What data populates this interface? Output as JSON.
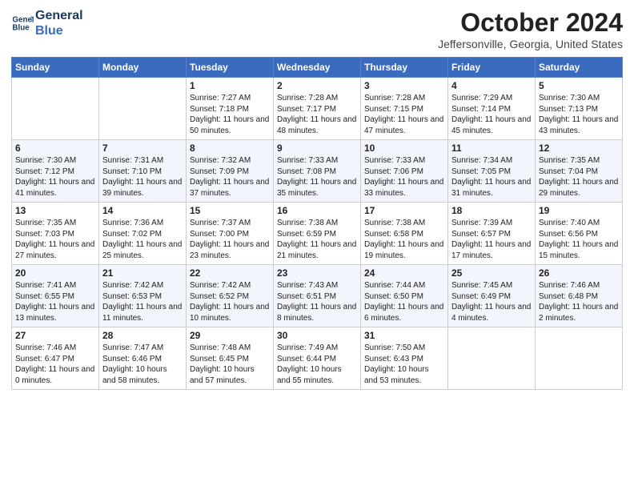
{
  "header": {
    "logo_line1": "General",
    "logo_line2": "Blue",
    "month_title": "October 2024",
    "location": "Jeffersonville, Georgia, United States"
  },
  "days_of_week": [
    "Sunday",
    "Monday",
    "Tuesday",
    "Wednesday",
    "Thursday",
    "Friday",
    "Saturday"
  ],
  "weeks": [
    [
      {
        "day": "",
        "sunrise": "",
        "sunset": "",
        "daylight": ""
      },
      {
        "day": "",
        "sunrise": "",
        "sunset": "",
        "daylight": ""
      },
      {
        "day": "1",
        "sunrise": "Sunrise: 7:27 AM",
        "sunset": "Sunset: 7:18 PM",
        "daylight": "Daylight: 11 hours and 50 minutes."
      },
      {
        "day": "2",
        "sunrise": "Sunrise: 7:28 AM",
        "sunset": "Sunset: 7:17 PM",
        "daylight": "Daylight: 11 hours and 48 minutes."
      },
      {
        "day": "3",
        "sunrise": "Sunrise: 7:28 AM",
        "sunset": "Sunset: 7:15 PM",
        "daylight": "Daylight: 11 hours and 47 minutes."
      },
      {
        "day": "4",
        "sunrise": "Sunrise: 7:29 AM",
        "sunset": "Sunset: 7:14 PM",
        "daylight": "Daylight: 11 hours and 45 minutes."
      },
      {
        "day": "5",
        "sunrise": "Sunrise: 7:30 AM",
        "sunset": "Sunset: 7:13 PM",
        "daylight": "Daylight: 11 hours and 43 minutes."
      }
    ],
    [
      {
        "day": "6",
        "sunrise": "Sunrise: 7:30 AM",
        "sunset": "Sunset: 7:12 PM",
        "daylight": "Daylight: 11 hours and 41 minutes."
      },
      {
        "day": "7",
        "sunrise": "Sunrise: 7:31 AM",
        "sunset": "Sunset: 7:10 PM",
        "daylight": "Daylight: 11 hours and 39 minutes."
      },
      {
        "day": "8",
        "sunrise": "Sunrise: 7:32 AM",
        "sunset": "Sunset: 7:09 PM",
        "daylight": "Daylight: 11 hours and 37 minutes."
      },
      {
        "day": "9",
        "sunrise": "Sunrise: 7:33 AM",
        "sunset": "Sunset: 7:08 PM",
        "daylight": "Daylight: 11 hours and 35 minutes."
      },
      {
        "day": "10",
        "sunrise": "Sunrise: 7:33 AM",
        "sunset": "Sunset: 7:06 PM",
        "daylight": "Daylight: 11 hours and 33 minutes."
      },
      {
        "day": "11",
        "sunrise": "Sunrise: 7:34 AM",
        "sunset": "Sunset: 7:05 PM",
        "daylight": "Daylight: 11 hours and 31 minutes."
      },
      {
        "day": "12",
        "sunrise": "Sunrise: 7:35 AM",
        "sunset": "Sunset: 7:04 PM",
        "daylight": "Daylight: 11 hours and 29 minutes."
      }
    ],
    [
      {
        "day": "13",
        "sunrise": "Sunrise: 7:35 AM",
        "sunset": "Sunset: 7:03 PM",
        "daylight": "Daylight: 11 hours and 27 minutes."
      },
      {
        "day": "14",
        "sunrise": "Sunrise: 7:36 AM",
        "sunset": "Sunset: 7:02 PM",
        "daylight": "Daylight: 11 hours and 25 minutes."
      },
      {
        "day": "15",
        "sunrise": "Sunrise: 7:37 AM",
        "sunset": "Sunset: 7:00 PM",
        "daylight": "Daylight: 11 hours and 23 minutes."
      },
      {
        "day": "16",
        "sunrise": "Sunrise: 7:38 AM",
        "sunset": "Sunset: 6:59 PM",
        "daylight": "Daylight: 11 hours and 21 minutes."
      },
      {
        "day": "17",
        "sunrise": "Sunrise: 7:38 AM",
        "sunset": "Sunset: 6:58 PM",
        "daylight": "Daylight: 11 hours and 19 minutes."
      },
      {
        "day": "18",
        "sunrise": "Sunrise: 7:39 AM",
        "sunset": "Sunset: 6:57 PM",
        "daylight": "Daylight: 11 hours and 17 minutes."
      },
      {
        "day": "19",
        "sunrise": "Sunrise: 7:40 AM",
        "sunset": "Sunset: 6:56 PM",
        "daylight": "Daylight: 11 hours and 15 minutes."
      }
    ],
    [
      {
        "day": "20",
        "sunrise": "Sunrise: 7:41 AM",
        "sunset": "Sunset: 6:55 PM",
        "daylight": "Daylight: 11 hours and 13 minutes."
      },
      {
        "day": "21",
        "sunrise": "Sunrise: 7:42 AM",
        "sunset": "Sunset: 6:53 PM",
        "daylight": "Daylight: 11 hours and 11 minutes."
      },
      {
        "day": "22",
        "sunrise": "Sunrise: 7:42 AM",
        "sunset": "Sunset: 6:52 PM",
        "daylight": "Daylight: 11 hours and 10 minutes."
      },
      {
        "day": "23",
        "sunrise": "Sunrise: 7:43 AM",
        "sunset": "Sunset: 6:51 PM",
        "daylight": "Daylight: 11 hours and 8 minutes."
      },
      {
        "day": "24",
        "sunrise": "Sunrise: 7:44 AM",
        "sunset": "Sunset: 6:50 PM",
        "daylight": "Daylight: 11 hours and 6 minutes."
      },
      {
        "day": "25",
        "sunrise": "Sunrise: 7:45 AM",
        "sunset": "Sunset: 6:49 PM",
        "daylight": "Daylight: 11 hours and 4 minutes."
      },
      {
        "day": "26",
        "sunrise": "Sunrise: 7:46 AM",
        "sunset": "Sunset: 6:48 PM",
        "daylight": "Daylight: 11 hours and 2 minutes."
      }
    ],
    [
      {
        "day": "27",
        "sunrise": "Sunrise: 7:46 AM",
        "sunset": "Sunset: 6:47 PM",
        "daylight": "Daylight: 11 hours and 0 minutes."
      },
      {
        "day": "28",
        "sunrise": "Sunrise: 7:47 AM",
        "sunset": "Sunset: 6:46 PM",
        "daylight": "Daylight: 10 hours and 58 minutes."
      },
      {
        "day": "29",
        "sunrise": "Sunrise: 7:48 AM",
        "sunset": "Sunset: 6:45 PM",
        "daylight": "Daylight: 10 hours and 57 minutes."
      },
      {
        "day": "30",
        "sunrise": "Sunrise: 7:49 AM",
        "sunset": "Sunset: 6:44 PM",
        "daylight": "Daylight: 10 hours and 55 minutes."
      },
      {
        "day": "31",
        "sunrise": "Sunrise: 7:50 AM",
        "sunset": "Sunset: 6:43 PM",
        "daylight": "Daylight: 10 hours and 53 minutes."
      },
      {
        "day": "",
        "sunrise": "",
        "sunset": "",
        "daylight": ""
      },
      {
        "day": "",
        "sunrise": "",
        "sunset": "",
        "daylight": ""
      }
    ]
  ]
}
